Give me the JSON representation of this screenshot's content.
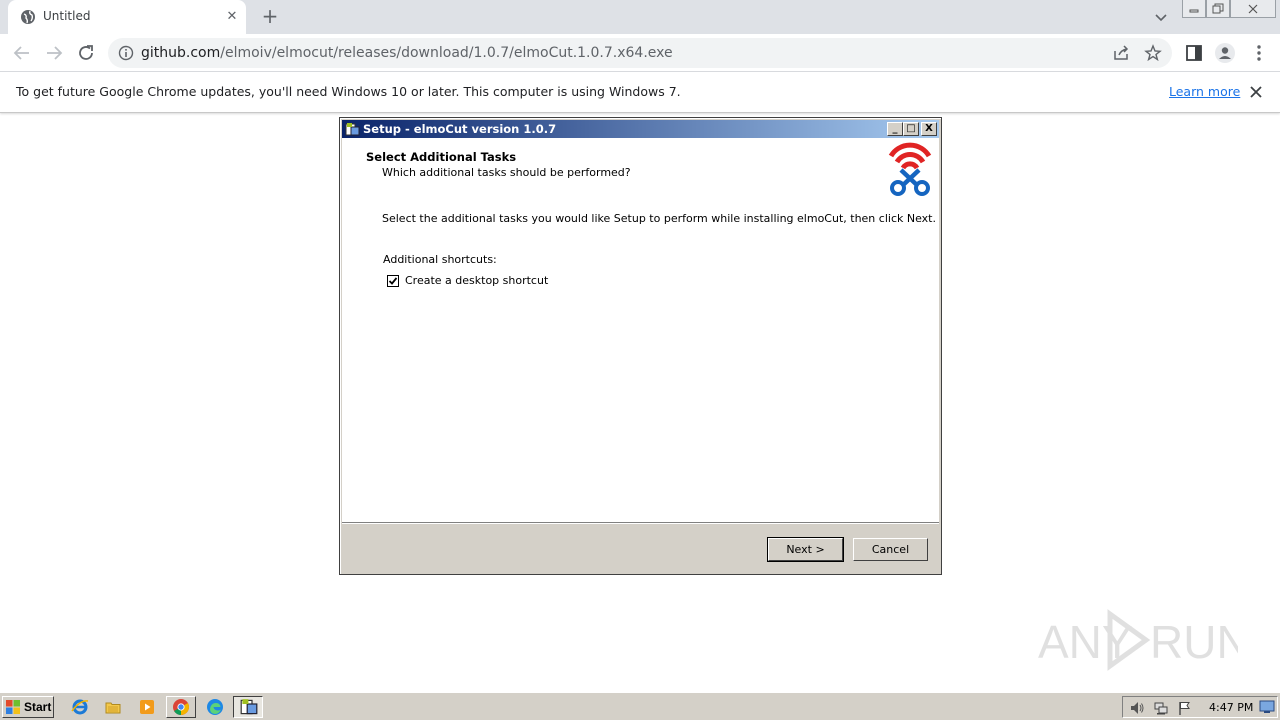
{
  "browser": {
    "tab": {
      "title": "Untitled",
      "close_icon": "close-icon"
    },
    "new_tab_label": "+",
    "url": {
      "host": "github.com",
      "path": "/elmoiv/elmocut/releases/download/1.0.7/elmoCut.1.0.7.x64.exe"
    },
    "infobar": {
      "message": "To get future Google Chrome updates, you'll need Windows 10 or later. This computer is using Windows 7.",
      "learn_more": "Learn more"
    }
  },
  "dialog": {
    "title": "Setup - elmoCut version 1.0.7",
    "heading": "Select Additional Tasks",
    "subheading": "Which additional tasks should be performed?",
    "instructions": "Select the additional tasks you would like Setup to perform while installing elmoCut, then click Next.",
    "group_label": "Additional shortcuts:",
    "checkbox": {
      "label": "Create a desktop shortcut",
      "checked": true
    },
    "next_button": "Next >",
    "cancel_button": "Cancel",
    "title_buttons": {
      "minimize": "_",
      "maximize": "□",
      "close": "X"
    }
  },
  "taskbar": {
    "start_label": "Start",
    "clock": "4:47 PM"
  },
  "watermark": {
    "text": "ANY RUN"
  },
  "colors": {
    "titlebar_start": "#0a246a",
    "titlebar_end": "#a6caf0",
    "link": "#1a73e8",
    "logo_red": "#e02424",
    "logo_blue": "#1565c0"
  }
}
